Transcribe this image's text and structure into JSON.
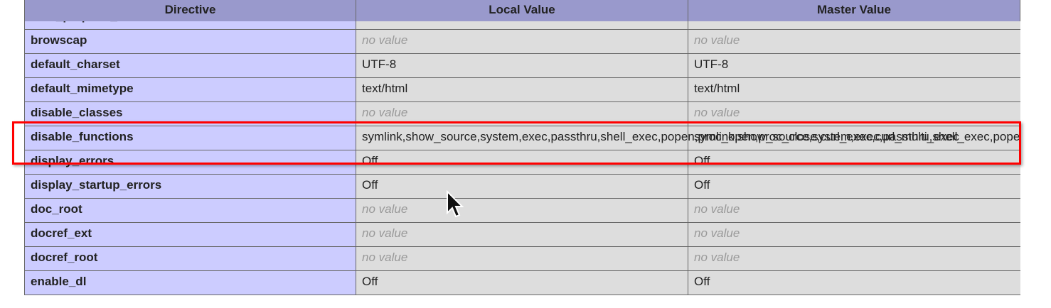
{
  "header": {
    "directive": "Directive",
    "local": "Local Value",
    "master": "Master Value"
  },
  "rows": [
    {
      "directive": "auto_prepend_file",
      "local": "",
      "master": "",
      "no_value": false
    },
    {
      "directive": "browscap",
      "local": "no value",
      "master": "no value",
      "no_value": true
    },
    {
      "directive": "default_charset",
      "local": "UTF-8",
      "master": "UTF-8",
      "no_value": false
    },
    {
      "directive": "default_mimetype",
      "local": "text/html",
      "master": "text/html",
      "no_value": false
    },
    {
      "directive": "disable_classes",
      "local": "no value",
      "master": "no value",
      "no_value": true
    },
    {
      "directive": "disable_functions",
      "local": "symlink,show_source,system,exec,passthru,shell_exec,popen,proc_open,proc_close,curl_exec,curl_multi_exec",
      "master": "symlink,show_source,system,exec,passthru,shell_exec,popen,proc_open,proc_close,curl_exec,curl_multi_exec",
      "no_value": false,
      "highlighted": true
    },
    {
      "directive": "display_errors",
      "local": "Off",
      "master": "Off",
      "no_value": false
    },
    {
      "directive": "display_startup_errors",
      "local": "Off",
      "master": "Off",
      "no_value": false
    },
    {
      "directive": "doc_root",
      "local": "no value",
      "master": "no value",
      "no_value": true
    },
    {
      "directive": "docref_ext",
      "local": "no value",
      "master": "no value",
      "no_value": true
    },
    {
      "directive": "docref_root",
      "local": "no value",
      "master": "no value",
      "no_value": true
    },
    {
      "directive": "enable_dl",
      "local": "Off",
      "master": "Off",
      "no_value": false
    }
  ],
  "colors": {
    "header": "#9999cc",
    "directive_cell": "#ccccff",
    "value_cell": "#dddddd",
    "no_value_text": "#999999",
    "highlight_box": "#ff0000"
  },
  "icons": {
    "cursor": "mouse-pointer-icon"
  }
}
